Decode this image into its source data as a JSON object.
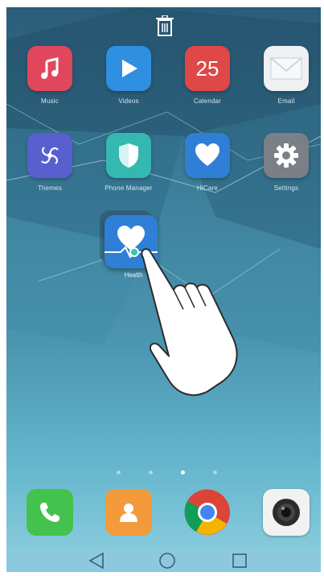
{
  "home": {
    "apps": [
      {
        "label": "Music",
        "icon": "music-note-icon",
        "color": "#e0475d"
      },
      {
        "label": "Videos",
        "icon": "play-icon",
        "color": "#2f8fe0"
      },
      {
        "label": "Calendar",
        "icon": "calendar-icon",
        "color": "#e04747",
        "day": "25"
      },
      {
        "label": "Email",
        "icon": "envelope-icon",
        "color": "#eef0f2"
      },
      {
        "label": "Themes",
        "icon": "pinwheel-icon",
        "color": "#5a5fd0"
      },
      {
        "label": "Phone Manager",
        "icon": "shield-icon",
        "color": "#35b8b0"
      },
      {
        "label": "HiCare",
        "icon": "heart-icon",
        "color": "#2f7fd6"
      },
      {
        "label": "Settings",
        "icon": "gear-icon",
        "color": "#7b7f86"
      }
    ],
    "dragging_app": {
      "label": "Health",
      "icon": "heart-pulse-icon",
      "color": "#2f7fd6"
    },
    "page_indicator": {
      "count": 4,
      "active_index": 2
    }
  },
  "dock": [
    {
      "name": "phone",
      "icon": "phone-icon",
      "color": "#44c24e"
    },
    {
      "name": "contacts",
      "icon": "contact-icon",
      "color": "#f39a3b"
    },
    {
      "name": "chrome",
      "icon": "chrome-icon",
      "color": "#ffffff"
    },
    {
      "name": "camera",
      "icon": "camera-icon",
      "color": "#f2f2f2"
    }
  ],
  "top_bar": {
    "icon": "trash-icon"
  },
  "nav": {
    "back": "back-icon",
    "home": "home-circle-icon",
    "recents": "recents-square-icon"
  }
}
